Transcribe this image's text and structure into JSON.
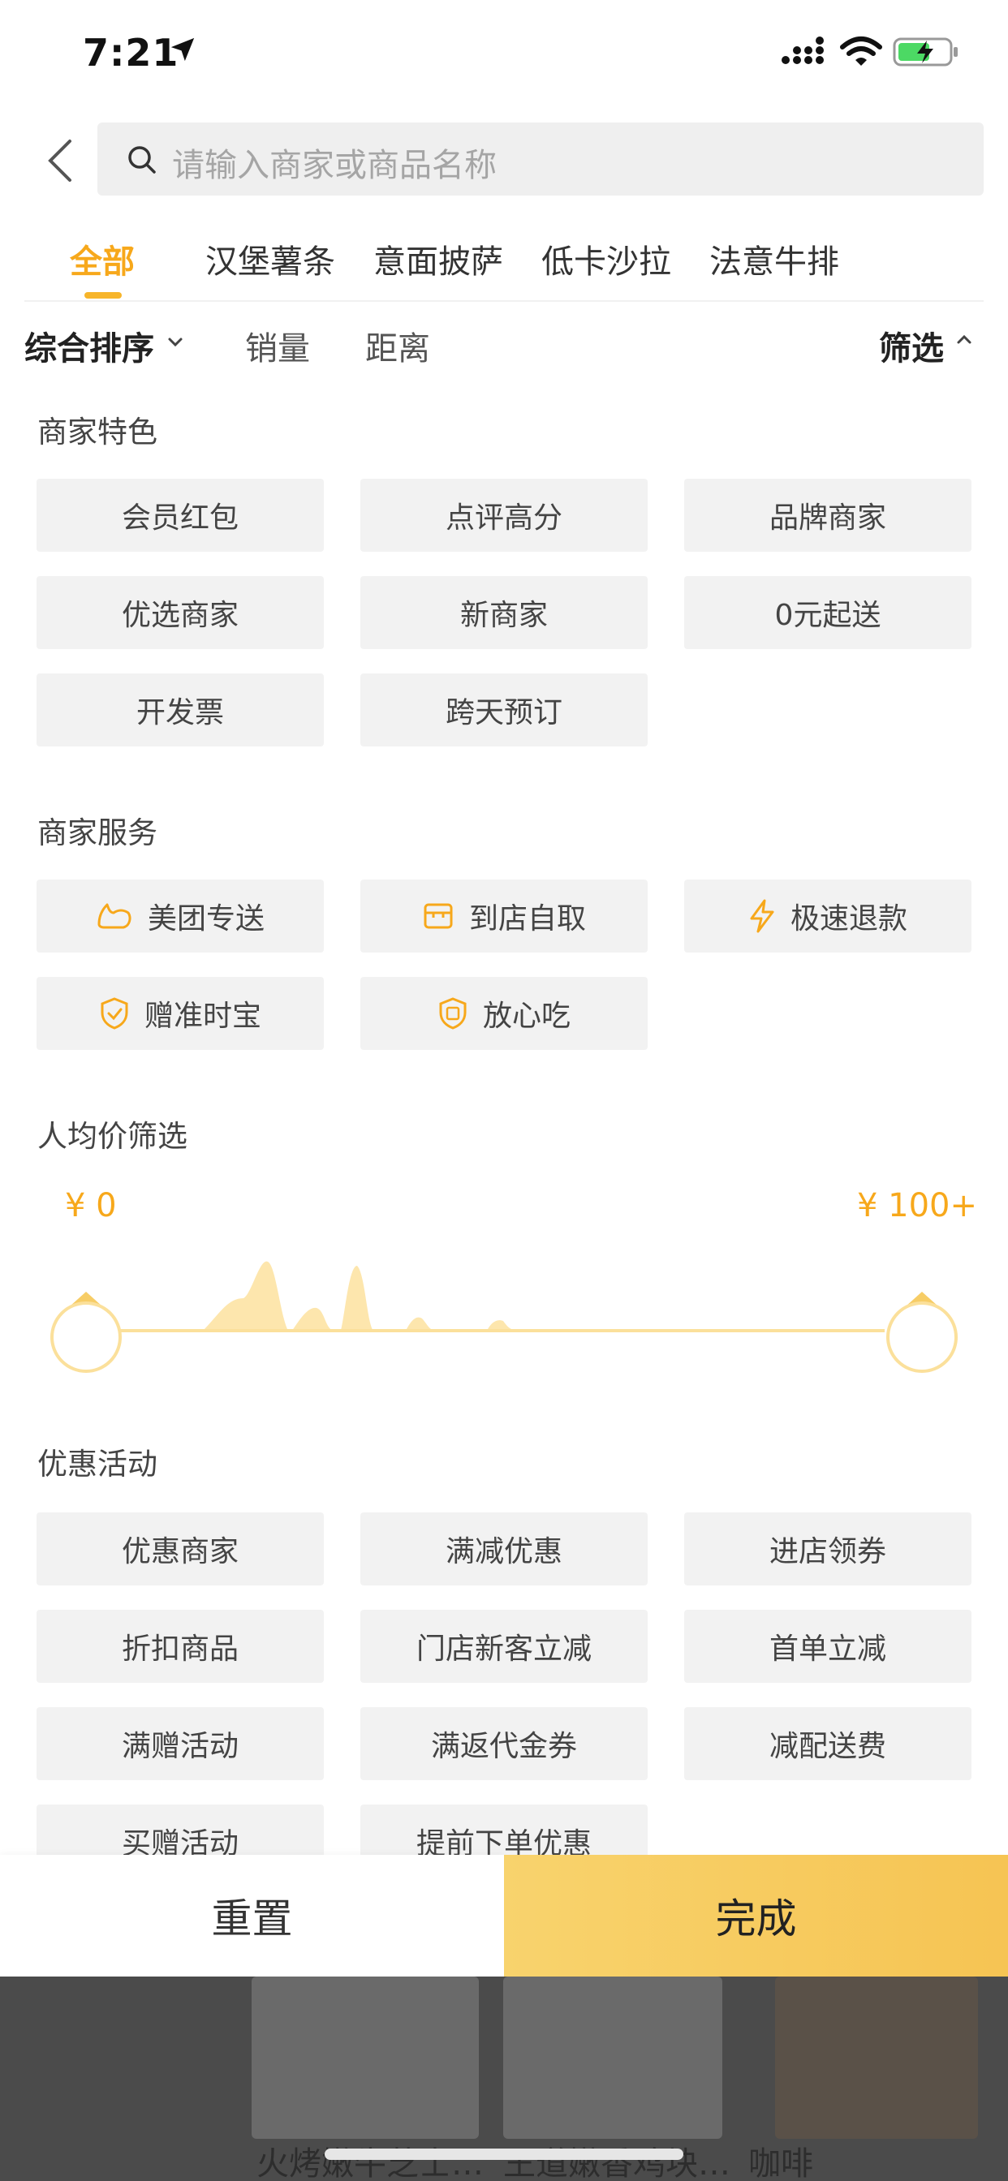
{
  "status_bar": {
    "time": "7:21"
  },
  "search": {
    "placeholder": "请输入商家或商品名称"
  },
  "tabs": [
    {
      "label": "全部",
      "active": true
    },
    {
      "label": "汉堡薯条"
    },
    {
      "label": "意面披萨"
    },
    {
      "label": "低卡沙拉"
    },
    {
      "label": "法意牛排"
    }
  ],
  "sort": {
    "composite": "综合排序",
    "sales": "销量",
    "distance": "距离",
    "filter": "筛选"
  },
  "features": {
    "title": "商家特色",
    "chips": [
      "会员红包",
      "点评高分",
      "品牌商家",
      "优选商家",
      "新商家",
      "0元起送",
      "开发票",
      "跨天预订"
    ]
  },
  "services": {
    "title": "商家服务",
    "chips": [
      {
        "label": "美团专送",
        "icon": "delivery-icon"
      },
      {
        "label": "到店自取",
        "icon": "store-icon"
      },
      {
        "label": "极速退款",
        "icon": "lightning-icon"
      },
      {
        "label": "赠准时宝",
        "icon": "shield-check-icon"
      },
      {
        "label": "放心吃",
        "icon": "shield-bao-icon"
      }
    ]
  },
  "price_filter": {
    "title": "人均价筛选",
    "min_label": "¥ 0",
    "max_label": "¥ 100+",
    "range": [
      0,
      100
    ]
  },
  "promotions": {
    "title": "优惠活动",
    "chips": [
      "优惠商家",
      "满减优惠",
      "进店领券",
      "折扣商品",
      "门店新客立减",
      "首单立减",
      "满赠活动",
      "满返代金券",
      "减配送费",
      "买赠活动",
      "提前下单优惠"
    ]
  },
  "footer": {
    "reset": "重置",
    "done": "完成"
  },
  "background_items": [
    "火烤嫩牛芝士…",
    "王道嫩香鸡块…",
    "咖啡"
  ],
  "colors": {
    "accent": "#f7a81b",
    "done_bg": "#f6c453",
    "chip_bg": "#f2f2f2"
  }
}
